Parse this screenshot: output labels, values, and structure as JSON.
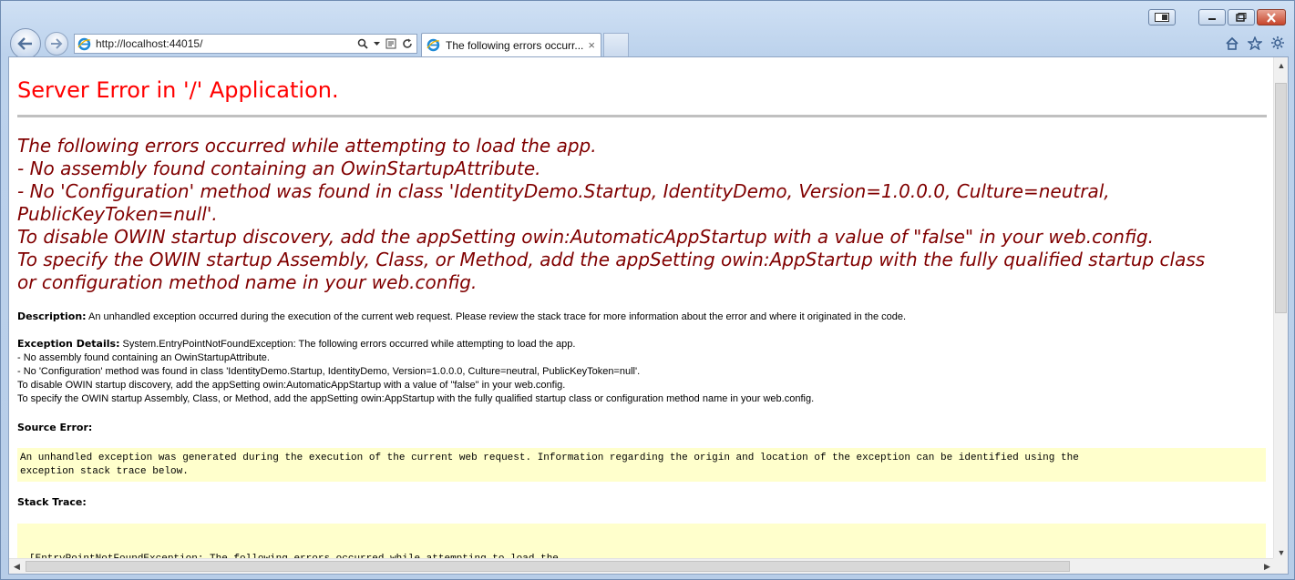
{
  "browser": {
    "address_url": "http://localhost:44015/",
    "tab_title": "The following errors occurr...",
    "tab_close": "×"
  },
  "page": {
    "heading": "Server Error in '/' Application.",
    "message_lines": [
      "The following errors occurred while attempting to load the app.",
      "- No assembly found containing an OwinStartupAttribute.",
      "- No 'Configuration' method was found in class 'IdentityDemo.Startup, IdentityDemo, Version=1.0.0.0, Culture=neutral,",
      "PublicKeyToken=null'.",
      "To disable OWIN startup discovery, add the appSetting owin:AutomaticAppStartup with a value of \"false\" in your web.config.",
      "To specify the OWIN startup Assembly, Class, or Method, add the appSetting owin:AppStartup with the fully qualified startup class",
      "or configuration method name in your web.config."
    ],
    "description_label": "Description:",
    "description_text": "An unhandled exception occurred during the execution of the current web request. Please review the stack trace for more information about the error and where it originated in the code.",
    "exception_label": "Exception Details:",
    "exception_first": "System.EntryPointNotFoundException: The following errors occurred while attempting to load the app.",
    "exception_lines": [
      "- No assembly found containing an OwinStartupAttribute.",
      "- No 'Configuration' method was found in class 'IdentityDemo.Startup, IdentityDemo, Version=1.0.0.0, Culture=neutral, PublicKeyToken=null'.",
      "To disable OWIN startup discovery, add the appSetting owin:AutomaticAppStartup with a value of \"false\" in your web.config.",
      "To specify the OWIN startup Assembly, Class, or Method, add the appSetting owin:AppStartup with the fully qualified startup class or configuration method name in your web.config."
    ],
    "source_error_label": "Source Error:",
    "source_error_lines": [
      "An unhandled exception was generated during the execution of the current web request. Information regarding the origin and location of the exception can be identified using the",
      "exception stack trace below."
    ],
    "stack_trace_label": "Stack Trace:",
    "stack_trace_first": "[EntryPointNotFoundException: The following errors occurred while attempting to load the"
  },
  "icons": {
    "back": "back-arrow-icon",
    "forward": "forward-arrow-icon",
    "ie": "ie-logo-icon",
    "search": "search-icon",
    "compat": "compatibility-view-icon",
    "refresh": "refresh-icon",
    "home": "home-icon",
    "favorites": "star-icon",
    "tools": "gear-icon"
  },
  "colors": {
    "heading": "#ff0000",
    "message": "#800000",
    "codebox": "#ffffcc"
  }
}
